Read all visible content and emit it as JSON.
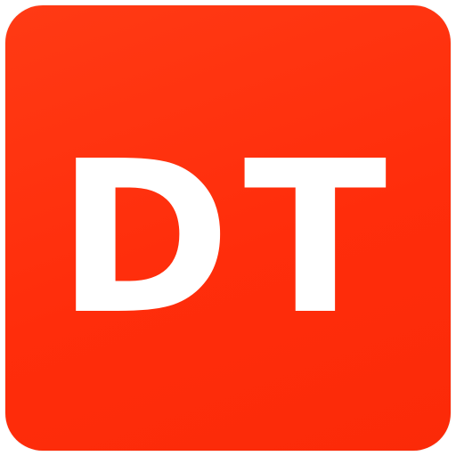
{
  "app_icon": {
    "monogram": "DT",
    "background_color": "#ff2d0b",
    "text_color": "#ffffff"
  }
}
